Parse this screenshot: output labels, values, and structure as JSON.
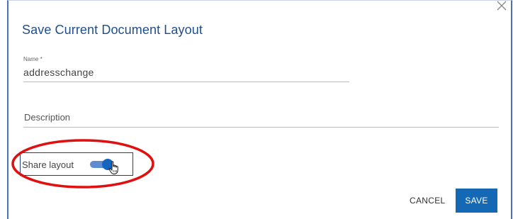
{
  "dialog": {
    "title": "Save Current Document Layout",
    "close_icon": "close-icon"
  },
  "name_field": {
    "label": "Name *",
    "value": "addresschange"
  },
  "description_field": {
    "placeholder": "Description",
    "value": ""
  },
  "share": {
    "label": "Share layout",
    "enabled": true
  },
  "actions": {
    "cancel_label": "CANCEL",
    "save_label": "SAVE"
  },
  "colors": {
    "accent": "#1568b3",
    "title": "#1f4e8c",
    "annotation": "#e01010"
  }
}
